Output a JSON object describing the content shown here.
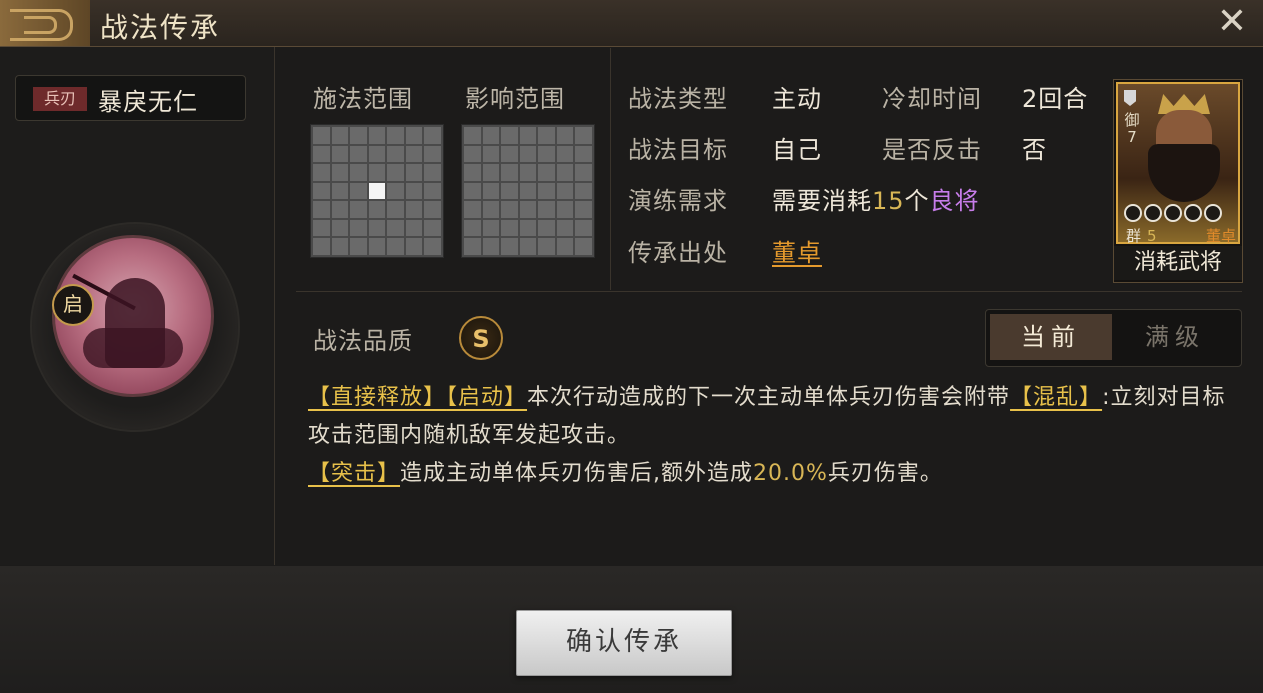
{
  "header": {
    "title": "战法传承",
    "close_icon": "close-icon"
  },
  "skill": {
    "tag": "兵刃",
    "name": "暴戾无仁",
    "badge": "启",
    "icon": "cavalry-skill-icon"
  },
  "ranges": {
    "cast_label": "施法范围",
    "effect_label": "影响范围",
    "cast_active_cell": 24
  },
  "info": {
    "type_key": "战法类型",
    "type_val": "主动",
    "cooldown_key": "冷却时间",
    "cooldown_val": "2回合",
    "target_key": "战法目标",
    "target_val": "自己",
    "counter_key": "是否反击",
    "counter_val": "否",
    "train_key": "演练需求",
    "train_prefix": "需要消耗",
    "train_count": "15",
    "train_unit": "个",
    "train_rarity": "良将",
    "origin_key": "传承出处",
    "origin_val": "董卓"
  },
  "general_card": {
    "side_text": "御",
    "cost_side": "7",
    "faction": "群",
    "cost": "5",
    "name": "董卓",
    "stars": 5,
    "caption": "消耗武将"
  },
  "quality": {
    "label": "战法品质",
    "grade": "S"
  },
  "toggle": {
    "current": "当前",
    "max": "满级"
  },
  "description": {
    "kw1": "【直接释放】",
    "kw2": "【启动】",
    "text1": "本次行动造成的下一次主动单体兵刃伤害会附带",
    "kw3": "【混乱】",
    "text2": ":立刻对目标攻击范围内随机敌军发起攻击。",
    "kw4": "【突击】",
    "text3": "造成主动单体兵刃伤害后,额外造成",
    "pct": "20.0%",
    "text4": "兵刃伤害。"
  },
  "footer": {
    "confirm": "确认传承"
  }
}
